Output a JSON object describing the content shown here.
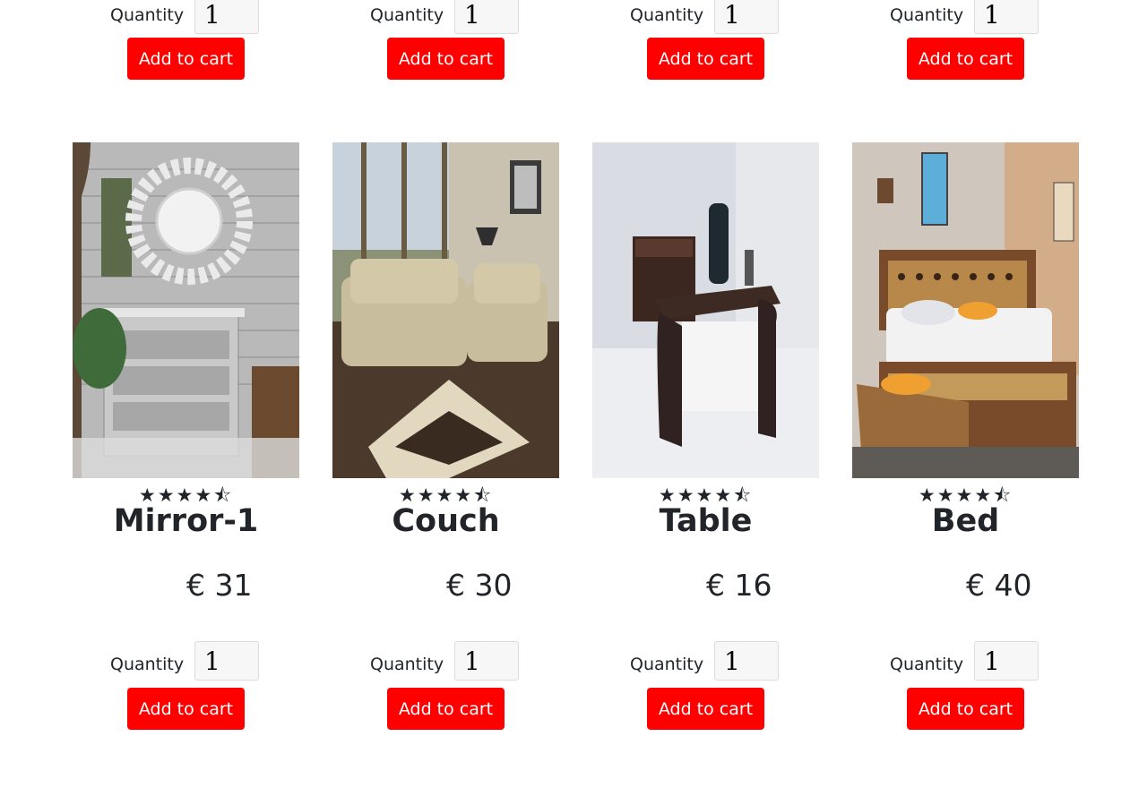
{
  "common": {
    "quantity_label": "Quantity",
    "quantity_value": "1",
    "add_to_cart": "Add to cart"
  },
  "top_row": [
    {},
    {},
    {},
    {}
  ],
  "products": [
    {
      "name": "Mirror-1",
      "price": "€ 31",
      "rating": 4.5,
      "stars": "★★★★⯪",
      "image": "mirror-photo"
    },
    {
      "name": "Couch",
      "price": "€ 30",
      "rating": 4.5,
      "stars": "★★★★⯪",
      "image": "couch-photo"
    },
    {
      "name": "Table",
      "price": "€ 16",
      "rating": 4.5,
      "stars": "★★★★⯪",
      "image": "office-table-photo"
    },
    {
      "name": "Bed",
      "price": "€ 40",
      "rating": 4.5,
      "stars": "★★★★⯪",
      "image": "bed-photo"
    }
  ],
  "colors": {
    "button": "#ff0000",
    "button_text": "#ffffff",
    "text": "#212529"
  }
}
